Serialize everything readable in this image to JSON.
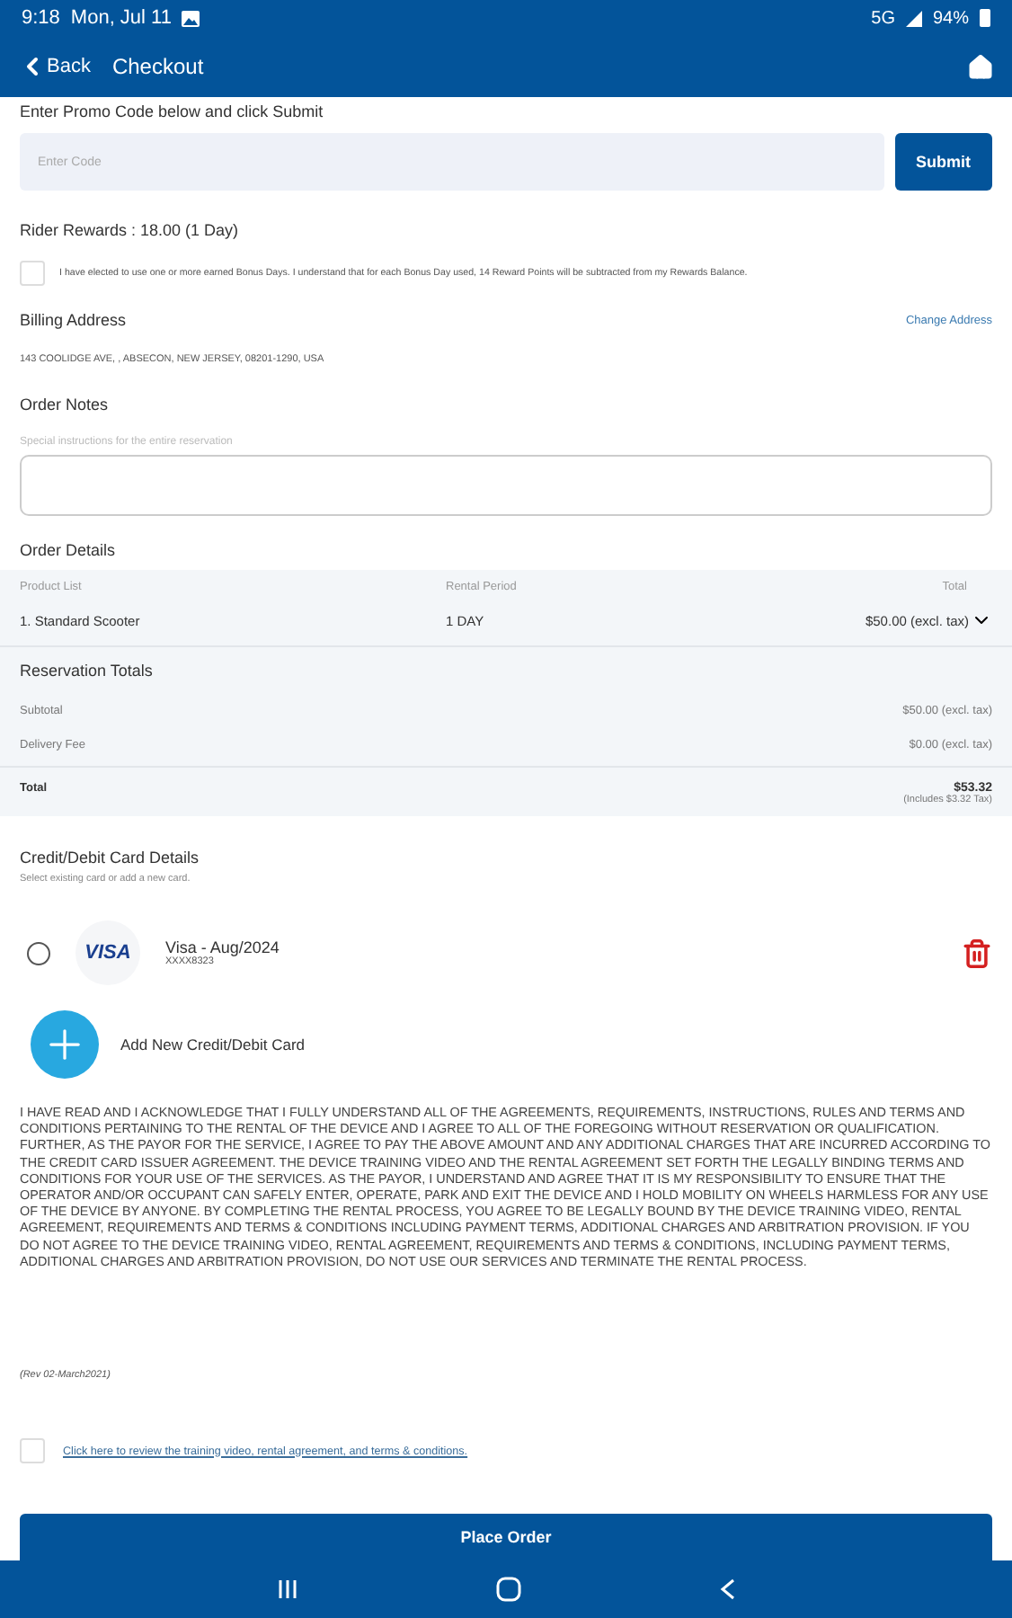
{
  "status_bar": {
    "time": "9:18",
    "date": "Mon, Jul 11",
    "network": "5G",
    "battery": "94%"
  },
  "app_bar": {
    "back": "Back",
    "title": "Checkout"
  },
  "promo": {
    "label": "Enter Promo Code below and click Submit",
    "placeholder": "Enter Code",
    "button": "Submit"
  },
  "rewards": {
    "label": "Rider Rewards : 18.00 (1 Day)",
    "checked": false,
    "text": "I have elected to use one or more earned Bonus Days. I understand that for each Bonus Day used, 14 Reward Points will be subtracted from my Rewards Balance."
  },
  "billing": {
    "title": "Billing Address",
    "link": "Change Address",
    "address": "143 COOLIDGE AVE, , ABSECON, NEW JERSEY, 08201-1290, USA"
  },
  "notes": {
    "title": "Order Notes",
    "hint": "Special instructions for the entire reservation"
  },
  "order_details": {
    "title": "Order Details",
    "columns": [
      "Product List",
      "Rental Period",
      "Total"
    ],
    "rows": [
      {
        "product": "1. Standard Scooter",
        "period": "1 DAY",
        "total": "$50.00 (excl. tax)"
      }
    ]
  },
  "reservation_totals": {
    "title": "Reservation Totals",
    "lines": [
      {
        "label": "Subtotal",
        "value": "$50.00 (excl. tax)"
      },
      {
        "label": "Delivery Fee",
        "value": "$0.00 (excl. tax)"
      }
    ],
    "total_label": "Total",
    "total_value": "$53.32",
    "total_note": "(Includes $3.32 Tax)"
  },
  "cards": {
    "title": "Credit/Debit Card Details",
    "subtitle": "Select existing card or add a new card.",
    "items": [
      {
        "brand": "VISA",
        "name": "Visa - Aug/2024",
        "number": "XXXX8323",
        "selected": false
      }
    ],
    "add": "Add New Credit/Debit Card"
  },
  "legal": "I HAVE READ AND I ACKNOWLEDGE THAT I FULLY UNDERSTAND ALL OF THE AGREEMENTS, REQUIREMENTS, INSTRUCTIONS, RULES AND TERMS AND CONDITIONS PERTAINING TO THE RENTAL OF THE DEVICE AND I AGREE TO ALL OF THE FOREGOING WITHOUT RESERVATION OR QUALIFICATION. FURTHER, AS THE PAYOR FOR THE SERVICE, I AGREE TO PAY THE ABOVE AMOUNT AND ANY ADDITIONAL CHARGES THAT ARE INCURRED ACCORDING TO THE CREDIT CARD ISSUER AGREEMENT. THE DEVICE TRAINING VIDEO AND THE RENTAL AGREEMENT SET FORTH THE LEGALLY BINDING TERMS AND CONDITIONS FOR YOUR USE OF THE SERVICES. AS THE PAYOR, I UNDERSTAND AND AGREE THAT IT IS MY RESPONSIBILITY TO ENSURE THAT THE OPERATOR AND/OR OCCUPANT CAN SAFELY ENTER, OPERATE, PARK AND EXIT THE DEVICE AND I HOLD MOBILITY ON WHEELS HARMLESS FOR ANY USE OF THE DEVICE BY ANYONE. BY COMPLETING THE RENTAL PROCESS, YOU AGREE TO BE LEGALLY BOUND BY THE DEVICE TRAINING VIDEO, RENTAL AGREEMENT, REQUIREMENTS AND TERMS & CONDITIONS INCLUDING PAYMENT TERMS, ADDITIONAL CHARGES AND ARBITRATION PROVISION. IF YOU DO NOT AGREE TO THE DEVICE TRAINING VIDEO, RENTAL AGREEMENT, REQUIREMENTS AND TERMS & CONDITIONS, INCLUDING PAYMENT TERMS, ADDITIONAL CHARGES AND ARBITRATION PROVISION, DO NOT USE OUR SERVICES AND TERMINATE THE RENTAL PROCESS.",
  "revision": "(Rev 02-March2021)",
  "terms": {
    "checked": false,
    "link": "Click here to review the training video, rental agreement, and terms & conditions."
  },
  "place_order": "Place Order"
}
